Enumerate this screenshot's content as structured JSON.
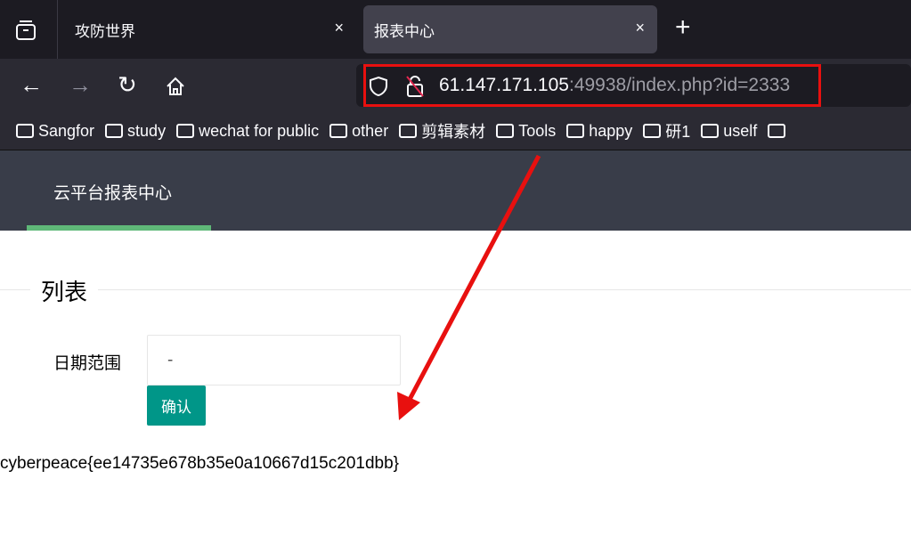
{
  "browser": {
    "tabs": [
      {
        "label": "攻防世界",
        "active": false
      },
      {
        "label": "报表中心",
        "active": true
      }
    ],
    "close_glyph": "×",
    "new_tab_glyph": "+",
    "url_host": "61.147.171.105",
    "url_rest": ":49938/index.php?id=2333",
    "bookmarks": [
      "Sangfor",
      "study",
      "wechat for public",
      "other",
      "剪辑素材",
      "Tools",
      "happy",
      "研1",
      "uself"
    ]
  },
  "page": {
    "brand": "云平台报表中心",
    "legend": "列表",
    "date_label": "日期范围",
    "date_value": "-",
    "confirm_label": "确认",
    "flag": "cyberpeace{ee14735e678b35e0a10667d15c201dbb}"
  },
  "annotation": {
    "color": "#e8100f"
  },
  "colors": {
    "header": "#393d49",
    "accent": "#5fb878",
    "button": "#009688"
  }
}
